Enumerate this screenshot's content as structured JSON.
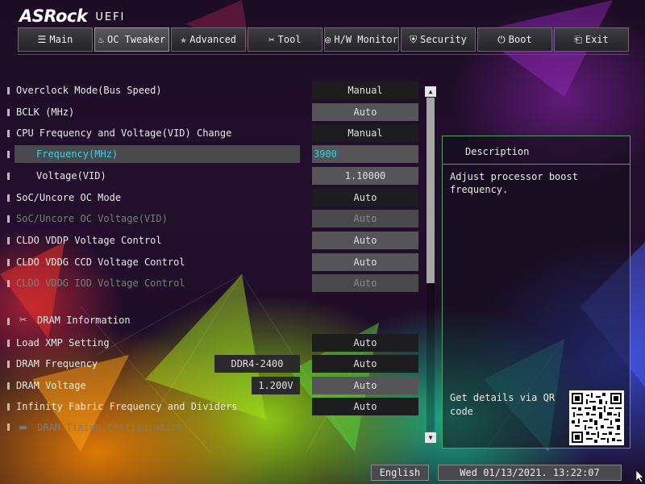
{
  "brand": {
    "logo": "ASRock",
    "uefi": "UEFI"
  },
  "tabs": [
    {
      "label": "Main",
      "icon": "list-icon",
      "glyph": "☰"
    },
    {
      "label": "OC Tweaker",
      "icon": "flame-icon",
      "glyph": "♨"
    },
    {
      "label": "Advanced",
      "icon": "star-icon",
      "glyph": "✯"
    },
    {
      "label": "Tool",
      "icon": "tools-icon",
      "glyph": "✂"
    },
    {
      "label": "H/W Monitor",
      "icon": "monitor-icon",
      "glyph": "◎"
    },
    {
      "label": "Security",
      "icon": "shield-icon",
      "glyph": "⛨"
    },
    {
      "label": "Boot",
      "icon": "power-icon",
      "glyph": "⏻"
    },
    {
      "label": "Exit",
      "icon": "exit-icon",
      "glyph": "⎗"
    }
  ],
  "active_tab": "OC Tweaker",
  "settings": [
    {
      "label": "Overclock Mode(Bus Speed)",
      "value": "Manual"
    },
    {
      "label": "BCLK (MHz)",
      "value": "Auto"
    },
    {
      "label": "CPU Frequency and Voltage(VID) Change",
      "value": "Manual"
    },
    {
      "label": "Frequency(MHz)",
      "value": "3900"
    },
    {
      "label": "Voltage(VID)",
      "value": "1.10000"
    },
    {
      "label": "SoC/Uncore OC Mode",
      "value": "Auto"
    },
    {
      "label": "SoC/Uncore OC Voltage(VID)",
      "value": "Auto"
    },
    {
      "label": "CLDO VDDP Voltage Control",
      "value": "Auto"
    },
    {
      "label": "CLDO VDDG CCD Voltage Control",
      "value": "Auto"
    },
    {
      "label": "CLDO VDDG IOD Voltage Control",
      "value": "Auto"
    },
    {
      "label": "DRAM Information"
    },
    {
      "label": "Load XMP Setting",
      "value": "Auto"
    },
    {
      "label": "DRAM Frequency",
      "value": "Auto",
      "readout": "DDR4-2400"
    },
    {
      "label": "DRAM Voltage",
      "value": "Auto",
      "readout": "1.200V"
    },
    {
      "label": "Infinity Fabric Frequency and Dividers",
      "value": "Auto"
    },
    {
      "label": "DRAM Timing Configuration"
    }
  ],
  "description": {
    "title": "Description",
    "text": "Adjust processor boost frequency.",
    "qr_text": "Get details via QR code"
  },
  "footer": {
    "language": "English",
    "datetime": "Wed 01/13/2021. 13:22:07"
  },
  "colors": {
    "selected_text": "#33d6e8",
    "panel_border": "#4fa35a"
  }
}
